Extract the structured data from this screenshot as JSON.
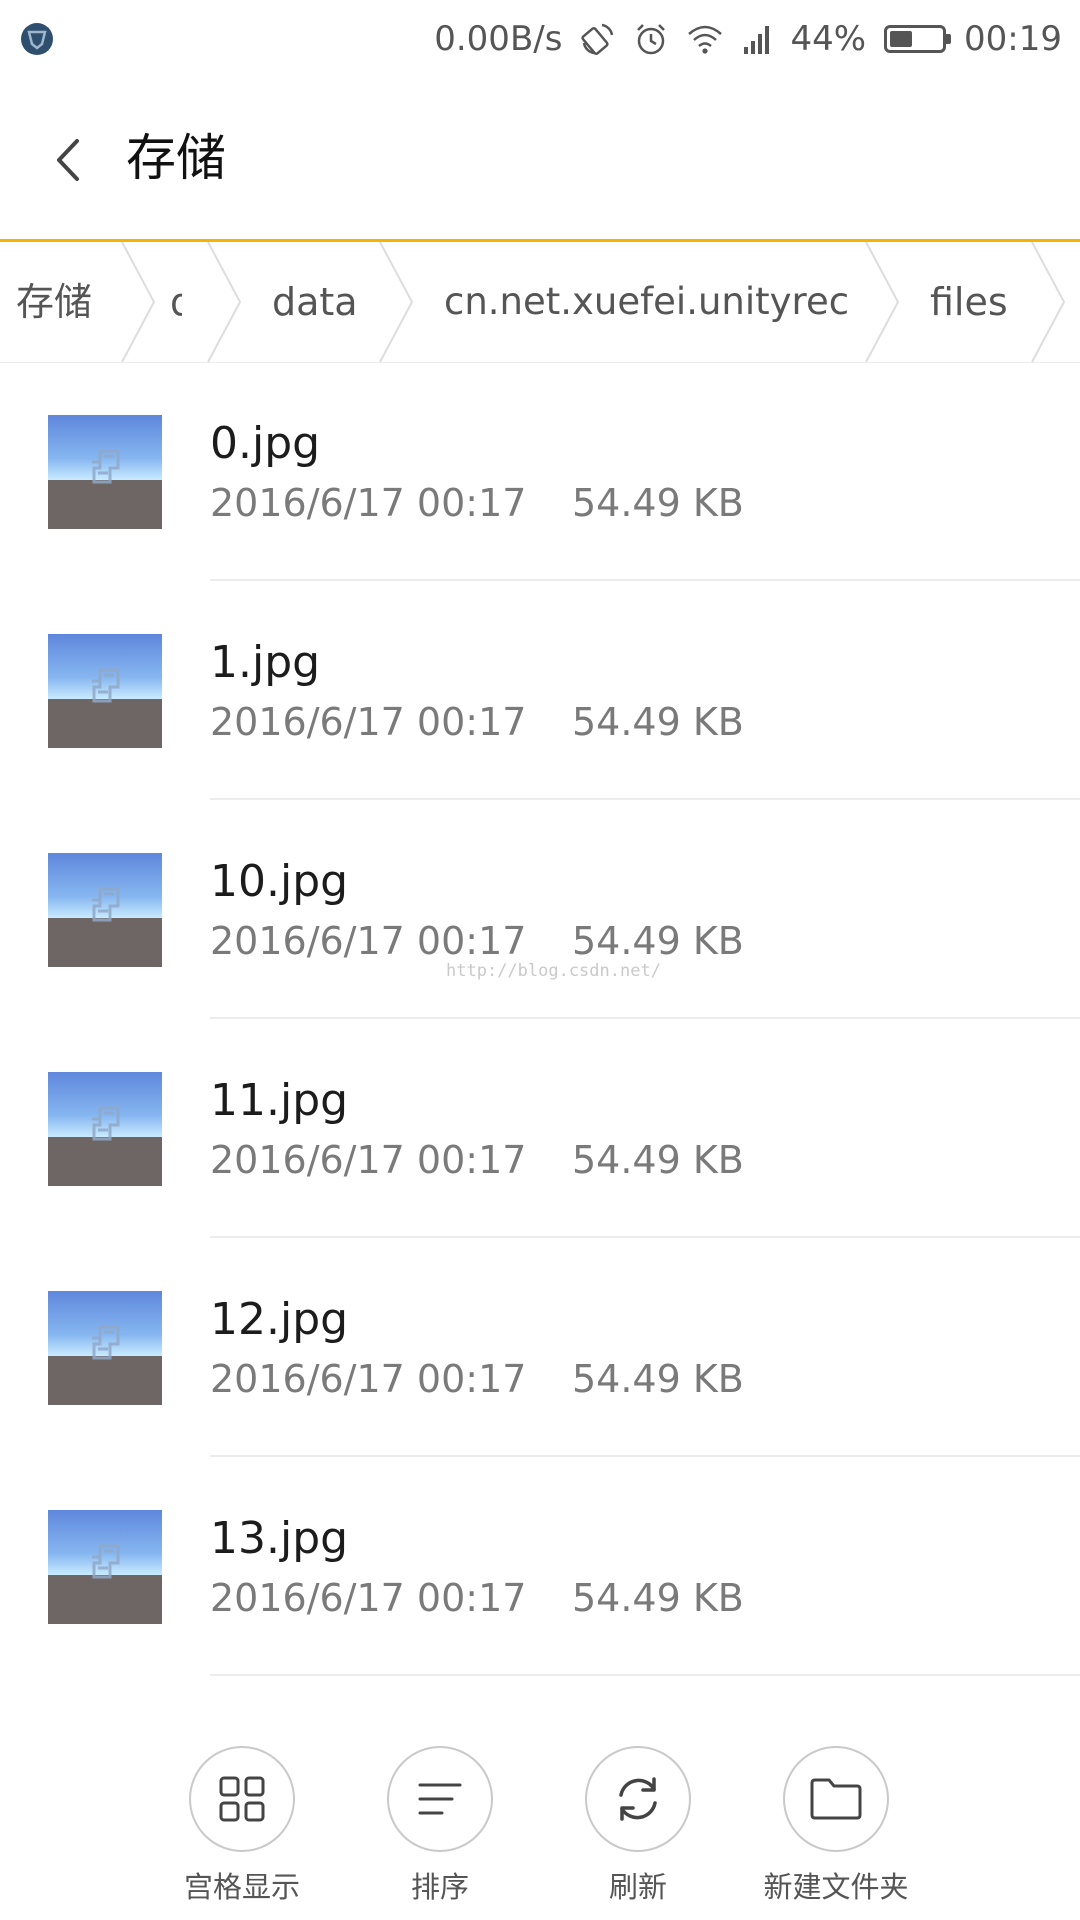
{
  "status_bar": {
    "net_speed": "0.00B/s",
    "battery_percent": "44%",
    "battery_level": 0.44,
    "time": "00:19",
    "icons": [
      "app-notification-icon",
      "rotation-icon",
      "alarm-icon",
      "wifi-icon",
      "signal-icon",
      "battery-icon"
    ]
  },
  "header": {
    "back_icon": "chevron-left-icon",
    "title": "存储"
  },
  "breadcrumb": [
    "存储",
    "d",
    "data",
    "cn.net.xuefei.unityrec",
    "files"
  ],
  "files": [
    {
      "name": "0.jpg",
      "date": "2016/6/17 00:17",
      "size": "54.49 KB"
    },
    {
      "name": "1.jpg",
      "date": "2016/6/17 00:17",
      "size": "54.49 KB"
    },
    {
      "name": "10.jpg",
      "date": "2016/6/17 00:17",
      "size": "54.49 KB"
    },
    {
      "name": "11.jpg",
      "date": "2016/6/17 00:17",
      "size": "54.49 KB"
    },
    {
      "name": "12.jpg",
      "date": "2016/6/17 00:17",
      "size": "54.49 KB"
    },
    {
      "name": "13.jpg",
      "date": "2016/6/17 00:17",
      "size": "54.49 KB"
    }
  ],
  "watermark": "http://blog.csdn.net/",
  "toolbar": [
    {
      "label": "宫格显示",
      "icon": "grid-view-icon"
    },
    {
      "label": "排序",
      "icon": "sort-icon"
    },
    {
      "label": "刷新",
      "icon": "refresh-icon"
    },
    {
      "label": "新建文件夹",
      "icon": "new-folder-icon"
    }
  ],
  "colors": {
    "accent": "#f5b400",
    "text_primary": "#1c1c1c",
    "text_secondary": "#7a7a7a",
    "divider": "#ececec"
  }
}
